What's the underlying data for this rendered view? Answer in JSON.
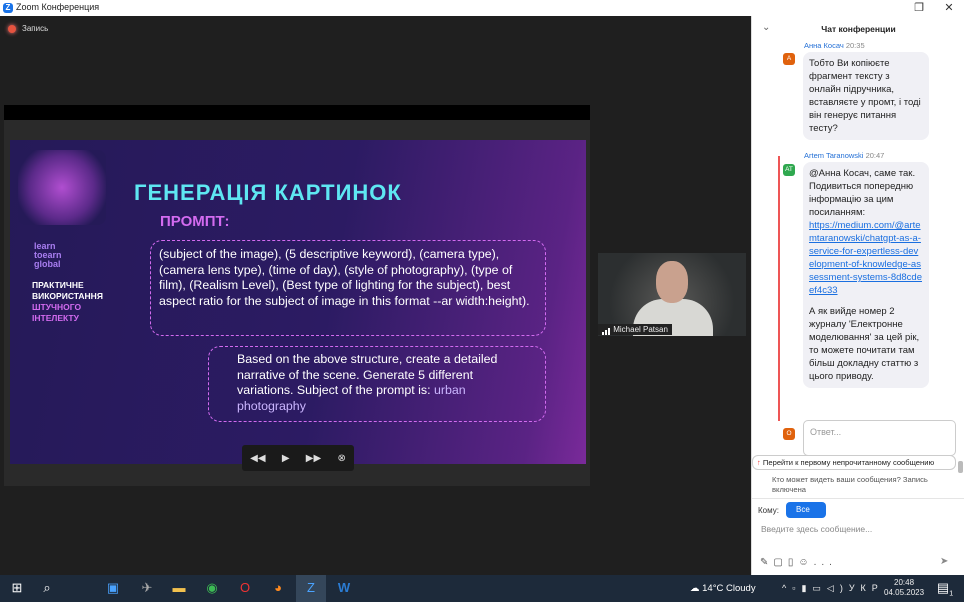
{
  "window": {
    "title": "Zoom Конференция",
    "minimize": "—",
    "maximize": "❐",
    "close": "✕"
  },
  "recording": {
    "label": "Запись"
  },
  "slide": {
    "brand": [
      "learn",
      "toearn",
      "global"
    ],
    "subtitle_white": [
      "ПРАКТИЧНЕ",
      "ВИКОРИСТАННЯ"
    ],
    "subtitle_pink": [
      "ШТУЧНОГО",
      "ІНТЕЛЕКТУ"
    ],
    "title": "ГЕНЕРАЦІЯ КАРТИНОК",
    "prompt_label": "ПРОМПТ:",
    "box1": "(subject of the image), (5 descriptive keyword), (camera type), (camera lens type), (time of day), (style of photography), (type of film), (Realism Level), (Best type of lighting for the subject), best aspect ratio for the subject of image in this format --ar width:height).",
    "box2": "Based on the above structure, create a detailed narrative of the scene. Generate 5 different variations. Subject of the prompt is:",
    "box2_subject": "urban photography"
  },
  "player": {
    "rewind": "◀◀",
    "play": "▶",
    "forward": "▶▶",
    "close": "⊗"
  },
  "video": {
    "name": "Michael Patsan"
  },
  "chat": {
    "header": "Чат конференции",
    "collapse": "⌄",
    "messages": [
      {
        "sender": "Анна Косач",
        "time": "20:35",
        "avatar": "A",
        "avatar_color": "#e0620d",
        "text": "Тобто Ви копіюєте фрагмент тексту з онлайн підручника, вставляєте у промт, і тоді він генерує питання тесту?"
      },
      {
        "sender": "Artem Taranowski",
        "time": "20:47",
        "avatar": "AT",
        "avatar_color": "#2fa84f",
        "text1": "@Анна Косач, саме так. Подивиться попередню інформацію за цим посиланням:",
        "link": "https://medium.com/@artemtaranowski/chatgpt-as-a-service-for-expertless-development-of-knowledge-assessment-systems-8d8cdeef4c33",
        "text2": "А як вийде номер 2 журналу 'Електронне моделювання' за цей рік, то можете почитати там більш докладну статтю з цього приводу."
      }
    ],
    "reply_avatar": "O",
    "reply_placeholder": "Ответ...",
    "unread_banner": "Перейти к первому непрочитанному сообщению",
    "privacy": "Кто может видеть ваши сообщения? Запись включена",
    "to_label": "Кому:",
    "to_value": "Все",
    "input_placeholder": "Введите здесь сообщение...",
    "more": "..."
  },
  "taskbar": {
    "weather": "14°C  Cloudy",
    "lang": "УКР",
    "time": "20:48",
    "date": "04.05.2023",
    "notifications": "1"
  }
}
